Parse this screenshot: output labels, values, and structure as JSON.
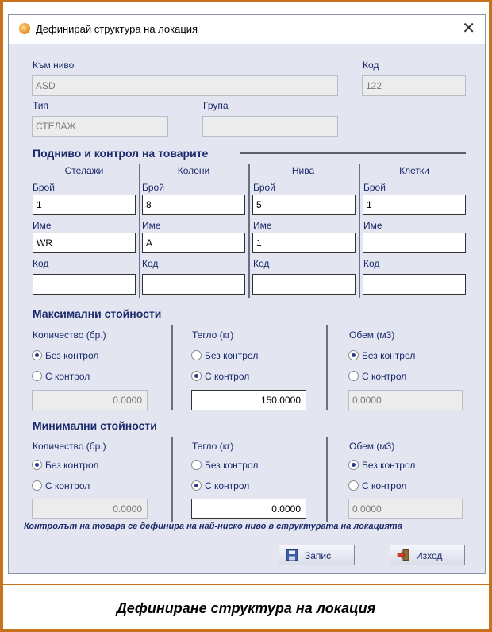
{
  "window": {
    "title": "Дефинирай структура на локация",
    "close_glyph": "✕"
  },
  "top": {
    "level_label": "Към ниво",
    "level_value": "ASD",
    "code_label": "Код",
    "code_value": "122",
    "type_label": "Тип",
    "type_value": "СТЕЛАЖ",
    "group_label": "Група",
    "group_value": ""
  },
  "sublevels": {
    "title": "Подниво и контрол на товарите",
    "columns": [
      {
        "head": "Стелажи",
        "count_label": "Брой",
        "count": "1",
        "name_label": "Име",
        "name": "WR",
        "code_label": "Код",
        "code": ""
      },
      {
        "head": "Колони",
        "count_label": "Брой",
        "count": "8",
        "name_label": "Име",
        "name": "A",
        "code_label": "Код",
        "code": ""
      },
      {
        "head": "Нива",
        "count_label": "Брой",
        "count": "5",
        "name_label": "Име",
        "name": "1",
        "code_label": "Код",
        "code": ""
      },
      {
        "head": "Клетки",
        "count_label": "Брой",
        "count": "1",
        "name_label": "Име",
        "name": "",
        "code_label": "Код",
        "code": ""
      }
    ]
  },
  "max": {
    "title": "Максимални стойности",
    "groups": [
      {
        "label": "Количество (бр.)",
        "opt1": "Без контрол",
        "opt2": "С контрол",
        "selected": 1,
        "value": "0.0000"
      },
      {
        "label": "Тегло (кг)",
        "opt1": "Без контрол",
        "opt2": "С контрол",
        "selected": 2,
        "value": "150.0000"
      },
      {
        "label": "Обем (м3)",
        "opt1": "Без контрол",
        "opt2": "С контрол",
        "selected": 1,
        "value": "0.0000"
      }
    ]
  },
  "min": {
    "title": "Минимални стойности",
    "groups": [
      {
        "label": "Количество (бр.)",
        "opt1": "Без контрол",
        "opt2": "С контрол",
        "selected": 1,
        "value": "0.0000"
      },
      {
        "label": "Тегло (кг)",
        "opt1": "Без контрол",
        "opt2": "С контрол",
        "selected": 2,
        "value": "0.0000"
      },
      {
        "label": "Обем (м3)",
        "opt1": "Без контрол",
        "opt2": "С контрол",
        "selected": 1,
        "value": "0.0000"
      }
    ]
  },
  "note": "Контролът на товара се дефинира на най-ниско ниво в структурата на локацията",
  "buttons": {
    "save": "Запис",
    "exit": "Изход",
    "save_icon": "floppy-icon",
    "exit_icon": "exit-door-icon"
  },
  "caption": "Дефиниране структура на локация",
  "colors": {
    "frame": "#c8711f",
    "dialog_bg": "#e3e6f1",
    "label": "#1b2a6b"
  }
}
